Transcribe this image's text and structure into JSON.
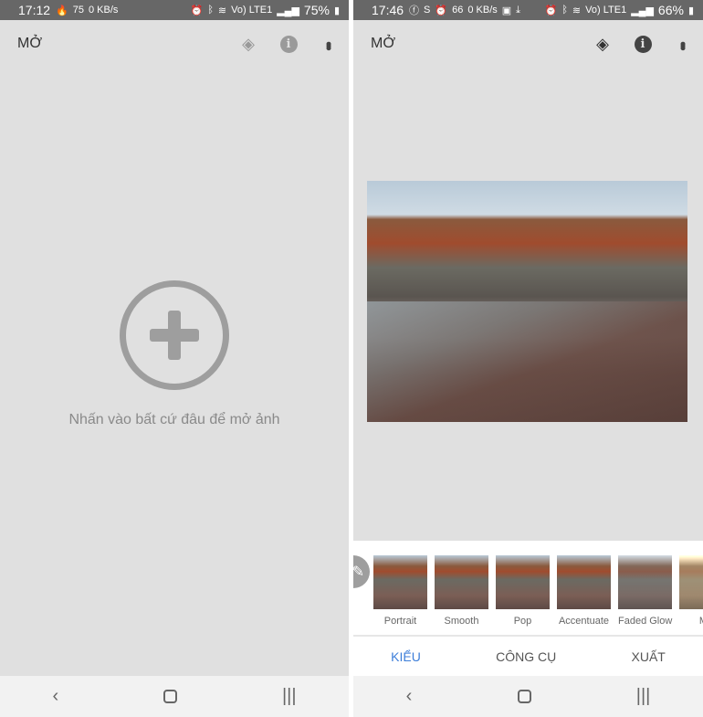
{
  "left": {
    "status": {
      "time": "17:12",
      "icons": [
        "flame-icon",
        "badge-75"
      ],
      "net_badge": "75",
      "speed": "0 KB/s",
      "volte": "Vo) LTE1",
      "battery": "75%"
    },
    "toolbar": {
      "title": "MỞ"
    },
    "hint": "Nhấn vào bất cứ đâu để mở ảnh"
  },
  "right": {
    "status": {
      "time": "17:46",
      "net_badge": "66",
      "speed": "0 KB/s",
      "volte": "Vo) LTE1",
      "battery": "66%"
    },
    "toolbar": {
      "title": "MỞ"
    },
    "filters": [
      {
        "label": "Portrait"
      },
      {
        "label": "Smooth"
      },
      {
        "label": "Pop"
      },
      {
        "label": "Accentuate"
      },
      {
        "label": "Faded Glow"
      },
      {
        "label": "Mo"
      }
    ],
    "tabs": [
      {
        "label": "KIỂU",
        "active": true
      },
      {
        "label": "CÔNG CỤ"
      },
      {
        "label": "XUẤT"
      }
    ]
  },
  "colors": {
    "accent": "#3d7ed9",
    "statusbar": "#676767",
    "canvas": "#e0e0e0"
  }
}
